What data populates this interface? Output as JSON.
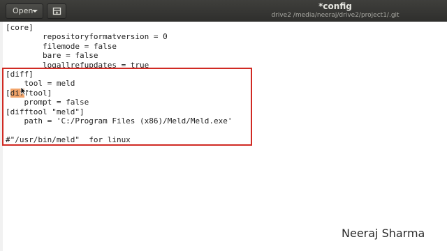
{
  "header": {
    "open_label": "Open",
    "title": "*config",
    "subtitle": "drive2 /media/neeraj/drive2/project1/.git"
  },
  "editor": {
    "lines": [
      "[core]",
      "        repositoryformatversion = 0",
      "        filemode = false",
      "        bare = false",
      "        logallrefupdates = true",
      "[diff]",
      "    tool = meld",
      "",
      "    prompt = false",
      "[difftool \"meld\"]",
      "    path = 'C:/Program Files (x86)/Meld/Meld.exe'",
      "",
      "#\"/usr/bin/meld\"  for linux"
    ],
    "line7_prefix": "[",
    "line7_highlight": "dif",
    "line7_suffix": "ftool]"
  },
  "watermark": "Neeraj Sharma",
  "colors": {
    "headerbar": "#2f2f2d",
    "annotation_box": "#d02a23",
    "selection": "#f2a46a"
  },
  "icons": {
    "open_dropdown": "chevron-down-icon",
    "new_tab": "new-document-icon",
    "pointer": "mouse-cursor-icon"
  }
}
